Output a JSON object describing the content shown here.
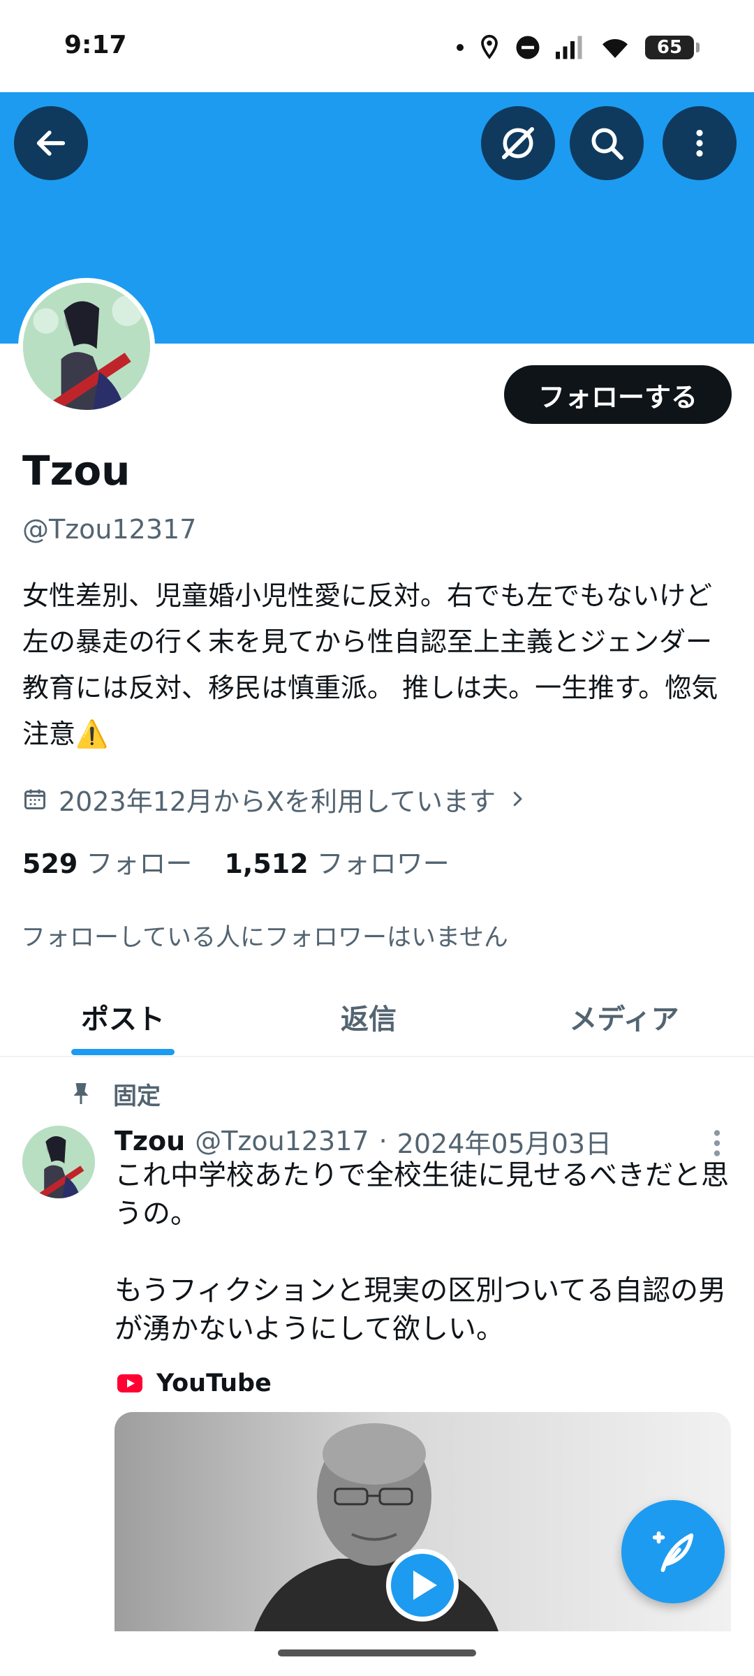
{
  "status_bar": {
    "time": "9:17",
    "battery": "65"
  },
  "profile": {
    "name": "Tzou",
    "handle": "@Tzou12317",
    "follow_button": "フォローする",
    "bio": "女性差別、児童婚小児性愛に反対。右でも左でもないけど左の暴走の行く末を見てから性自認至上主義とジェンダー教育には反対、移民は慎重派。 推しは夫。一生推す。惚気注意⚠️",
    "joined": "2023年12月からXを利用しています",
    "following_count": "529",
    "following_label": "フォロー",
    "followers_count": "1,512",
    "followers_label": "フォロワー",
    "followers_you_know": "フォローしている人にフォロワーはいません"
  },
  "tabs": [
    {
      "label": "ポスト",
      "active": true
    },
    {
      "label": "返信",
      "active": false
    },
    {
      "label": "メディア",
      "active": false
    }
  ],
  "pinned_tweet": {
    "pinned_label": "固定",
    "author_name": "Tzou",
    "author_handle": "@Tzou12317",
    "separator": "·",
    "date": "2024年05月03日",
    "text": "これ中学校あたりで全校生徒に見せるべきだと思うの。\n\nもうフィクションと現実の区別ついてる自認の男が湧かないようにして欲しい。",
    "link_source": "YouTube"
  },
  "icons": {
    "back": "arrow-left-icon",
    "grok": "grok-icon",
    "search": "search-icon",
    "more": "more-vertical-icon",
    "calendar": "calendar-icon",
    "chevron": "chevron-right-icon",
    "pin": "pin-icon",
    "compose": "compose-post-icon",
    "play": "play-icon"
  },
  "colors": {
    "accent": "#1d9bf0",
    "banner": "#1d9bf0",
    "text_primary": "#0f1419",
    "text_secondary": "#536471",
    "youtube_red": "#ff0033"
  }
}
